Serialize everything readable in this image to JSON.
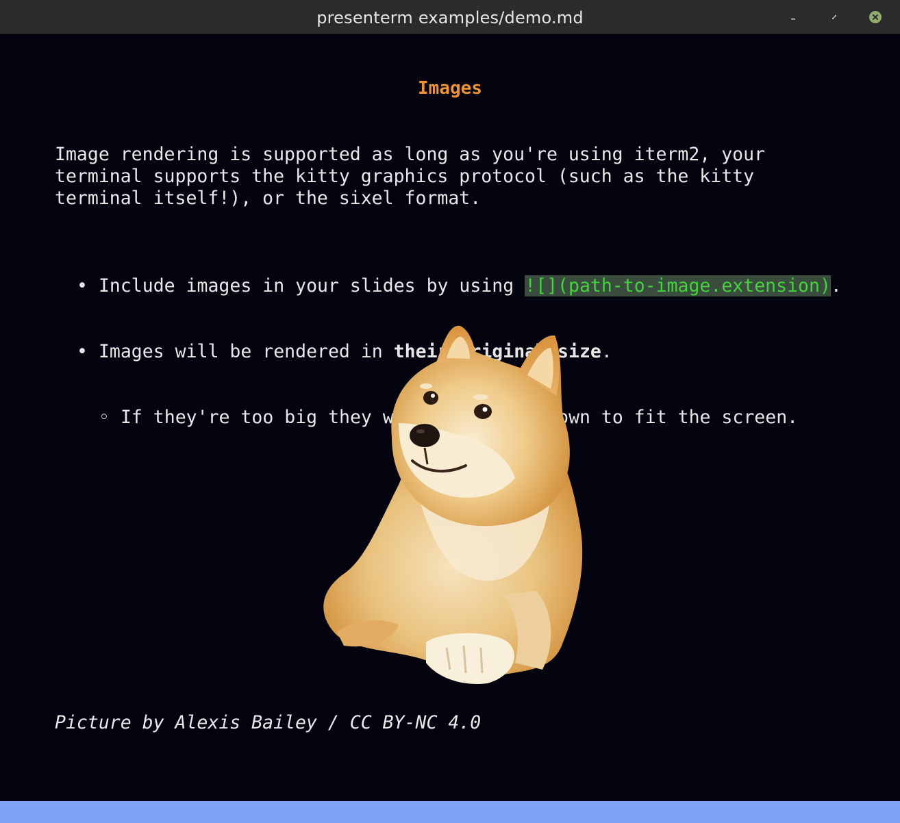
{
  "window": {
    "title": "presenterm examples/demo.md"
  },
  "slide": {
    "title": "Images",
    "paragraph_lines": [
      "Image rendering is supported as long as you're using iterm2, your",
      "terminal supports the kitty graphics protocol (such as the kitty",
      "terminal itself!), or the sixel format."
    ],
    "bullets": [
      {
        "marker": "•",
        "text_before": "Include images in your slides by using ",
        "code": "![](path-to-image.extension)",
        "text_after": "."
      },
      {
        "marker": "•",
        "text_before": "Images will be rendered in ",
        "bold": "their original size",
        "text_after": "."
      }
    ],
    "sub_bullets": [
      {
        "marker": "◦",
        "text": "If they're too big they will be scaled down to fit the screen."
      }
    ],
    "image": {
      "icon": "doge-shiba-inu-image"
    },
    "caption": "Picture by Alexis Bailey / CC BY-NC 4.0"
  },
  "colors": {
    "background": "#03040f",
    "title": "#ee9330",
    "code_fg": "#43d33a",
    "code_bg": "#3a4c3d",
    "footer_bar": "#7ea2f4",
    "titlebar": "#2b2b2b"
  }
}
